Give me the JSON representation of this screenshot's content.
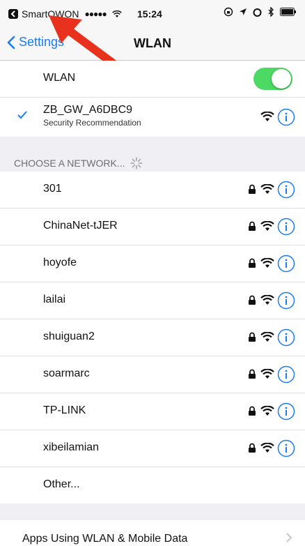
{
  "status_bar": {
    "carrier": "SmartQWON",
    "signal": "●●●●●",
    "time": "15:24",
    "back_icon": "back-app-icon",
    "icons": [
      "wifi-icon",
      "screen-lock-icon",
      "location-icon",
      "alarm-icon",
      "bluetooth-icon",
      "battery-icon"
    ]
  },
  "nav": {
    "back_label": "Settings",
    "title": "WLAN"
  },
  "wlan_toggle": {
    "label": "WLAN",
    "on": true,
    "color": "#4cd964"
  },
  "connected": {
    "name": "ZB_GW_A6DBC9",
    "subtitle": "Security Recommendation"
  },
  "section_header": "CHOOSE A NETWORK...",
  "networks": [
    {
      "name": "301"
    },
    {
      "name": "ChinaNet-tJER"
    },
    {
      "name": "hoyofe"
    },
    {
      "name": "lailai"
    },
    {
      "name": "shuiguan2"
    },
    {
      "name": "soarmarc"
    },
    {
      "name": "TP-LINK"
    },
    {
      "name": "xibeilamian"
    }
  ],
  "other_label": "Other...",
  "apps_row": {
    "label": "Apps Using WLAN & Mobile Data"
  },
  "colors": {
    "accent": "#1a7cf5",
    "annotation_arrow": "#e8321e"
  }
}
